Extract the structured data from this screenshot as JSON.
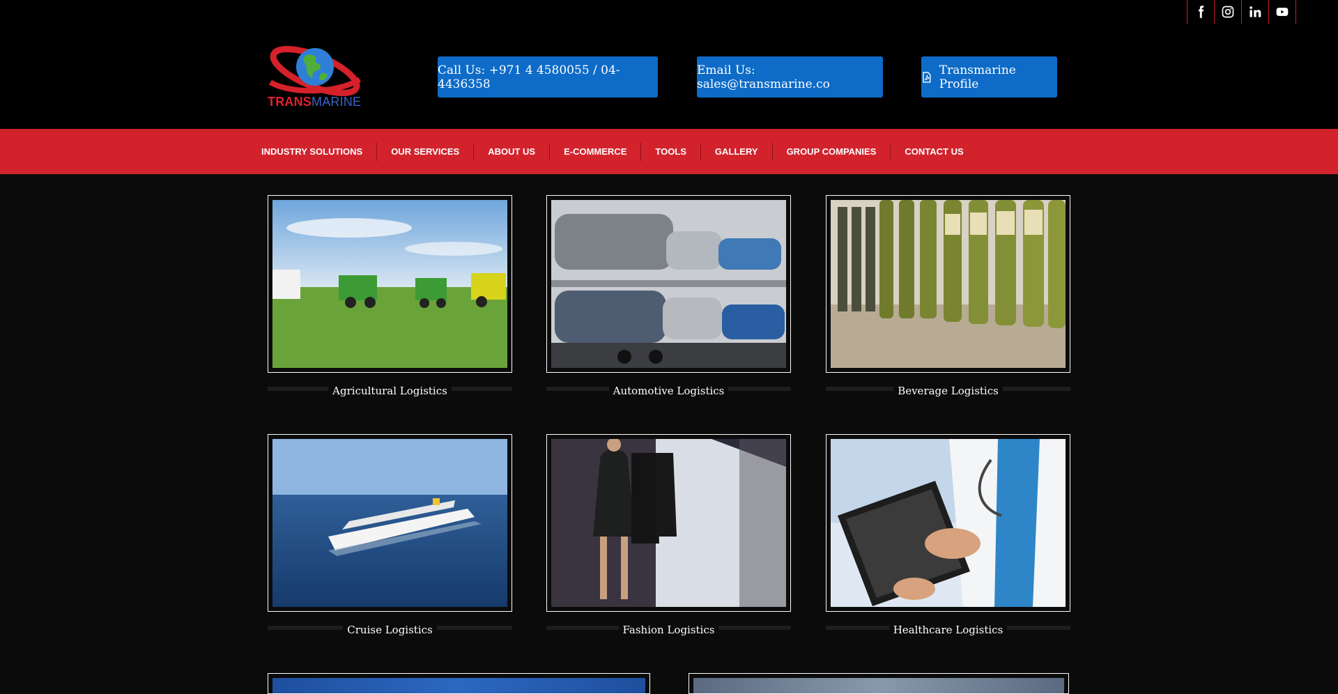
{
  "header": {
    "logo": {
      "word1": "TRANS",
      "word2": "MARINE"
    },
    "social": [
      {
        "name": "facebook-icon"
      },
      {
        "name": "instagram-icon"
      },
      {
        "name": "linkedin-icon"
      },
      {
        "name": "youtube-icon"
      }
    ],
    "buttons": {
      "call": "Call Us: +971 4 4580055 / 04-4436358",
      "email": "Email Us: sales@transmarine.co",
      "profile": "Transmarine Profile"
    }
  },
  "nav": {
    "items": [
      "INDUSTRY SOLUTIONS",
      "OUR SERVICES",
      "ABOUT US",
      "E-COMMERCE",
      "TOOLS",
      "GALLERY",
      "GROUP COMPANIES",
      "CONTACT US"
    ]
  },
  "solutions": [
    {
      "label": "Agricultural Logistics"
    },
    {
      "label": "Automotive Logistics"
    },
    {
      "label": "Beverage Logistics"
    },
    {
      "label": "Cruise Logistics"
    },
    {
      "label": "Fashion Logistics"
    },
    {
      "label": "Healthcare Logistics"
    }
  ],
  "colors": {
    "nav_bg": "#d2232d",
    "button_bg": "#0e6bc7",
    "page_bg": "#0b0b0c",
    "header_bg": "#000000"
  }
}
